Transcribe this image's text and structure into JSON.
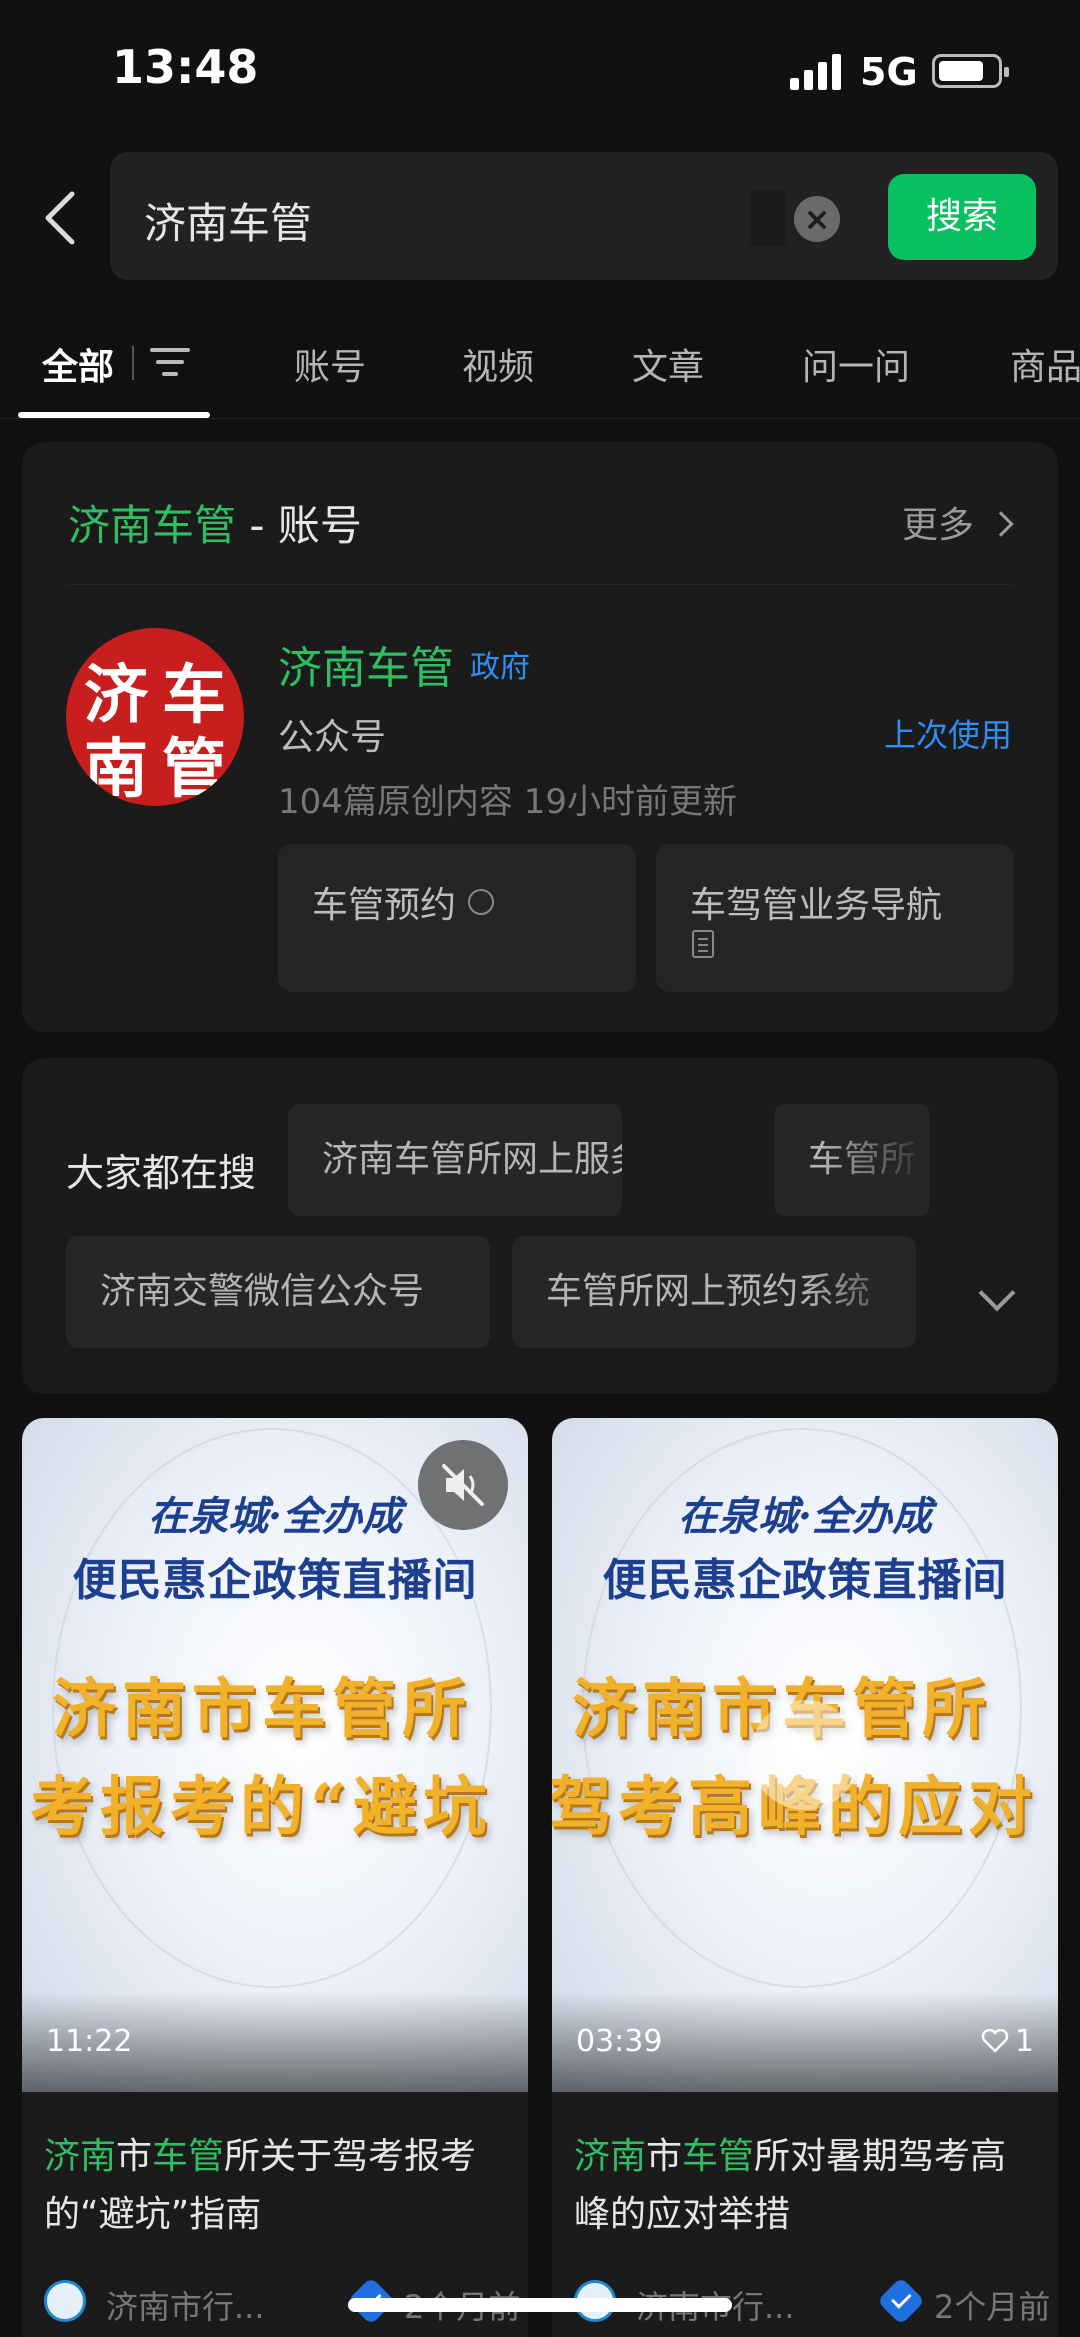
{
  "status": {
    "time": "13:48",
    "network": "5G"
  },
  "search": {
    "query": "济南车管",
    "button": "搜索"
  },
  "tabs": [
    "全部",
    "账号",
    "视频",
    "文章",
    "问一问",
    "商品"
  ],
  "account_section": {
    "title_highlight": "济南车管",
    "title_rest": " - 账号",
    "more": "更多",
    "name": "济南车管",
    "badge": "政府",
    "type": "公众号",
    "last_used": "上次使用",
    "stats": "104篇原创内容   19小时前更新",
    "services": [
      "车管预约",
      "车驾管业务导航"
    ],
    "avatar_text": [
      "济",
      "车",
      "南",
      "管"
    ]
  },
  "trending": {
    "label": "大家都在搜",
    "chips": [
      "济南车管所网上服务厅",
      "车管所",
      "济南交警微信公众号",
      "车管所网上预约系统"
    ]
  },
  "videos": [
    {
      "thumb_line1": "在泉城·全办成",
      "thumb_line2": "便民惠企政策直播间",
      "thumb_big1": "济南市车管所",
      "thumb_big2": "考报考的“避坑",
      "duration": "11:22",
      "title_parts": [
        "济南",
        "市",
        "车管",
        "所关于驾考报考的“避坑”指南"
      ],
      "source": "济南市行...",
      "age": "2个月前"
    },
    {
      "thumb_line1": "在泉城·全办成",
      "thumb_line2": "便民惠企政策直播间",
      "thumb_big1": "济南市车管所",
      "thumb_big2": "驾考高峰的应对",
      "duration": "03:39",
      "likes": "1",
      "title_parts": [
        "济南",
        "市",
        "车管",
        "所对暑期驾考高峰的应对举措"
      ],
      "source": "济南市行...",
      "age": "2个月前"
    }
  ],
  "colors": {
    "accent_green": "#07c160",
    "link_blue": "#2f8ef2",
    "background": "#111111"
  }
}
